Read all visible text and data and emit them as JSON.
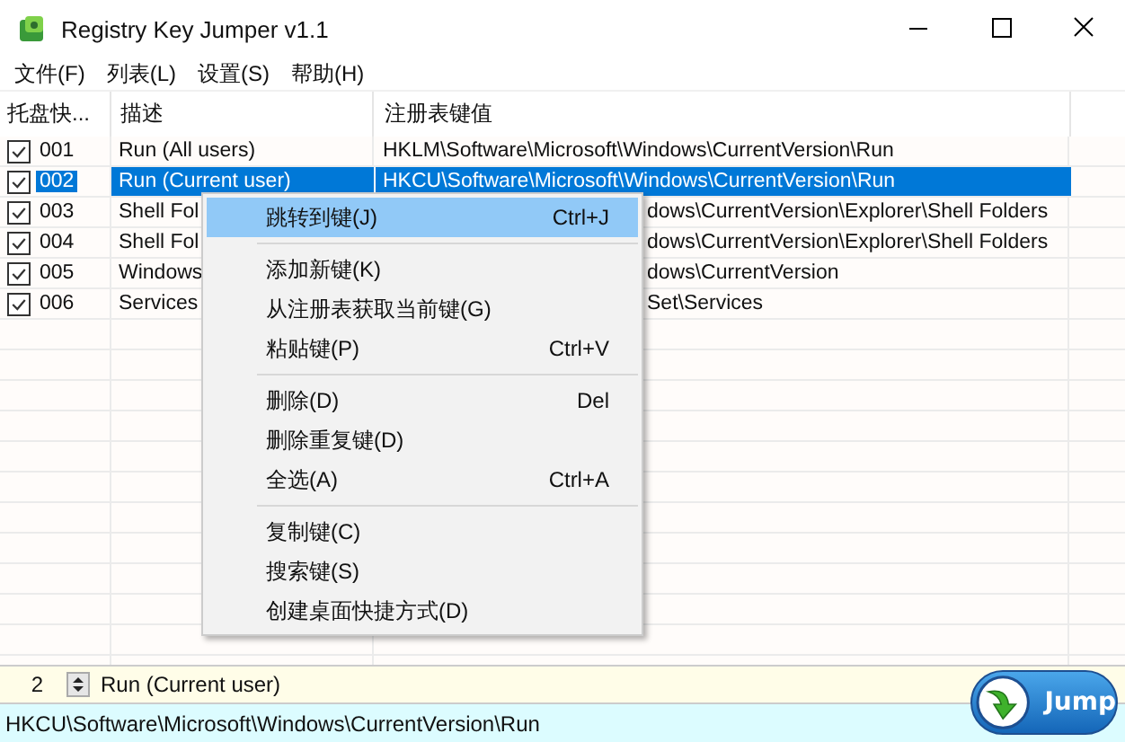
{
  "window": {
    "title": "Registry Key Jumper v1.1"
  },
  "menu_bar": [
    "文件(F)",
    "列表(L)",
    "设置(S)",
    "帮助(H)"
  ],
  "table": {
    "columns": [
      "托盘快...",
      "描述",
      "注册表键值"
    ],
    "rows": [
      {
        "checked": true,
        "selected": false,
        "covered": false,
        "number": "001",
        "description": "Run (All users)",
        "value": "HKLM\\Software\\Microsoft\\Windows\\CurrentVersion\\Run"
      },
      {
        "checked": true,
        "selected": true,
        "covered": false,
        "number": "002",
        "description": "Run (Current user)",
        "value": "HKCU\\Software\\Microsoft\\Windows\\CurrentVersion\\Run"
      },
      {
        "checked": true,
        "selected": false,
        "covered": true,
        "number": "003",
        "description": "Shell Fol",
        "value": "dows\\CurrentVersion\\Explorer\\Shell Folders"
      },
      {
        "checked": true,
        "selected": false,
        "covered": true,
        "number": "004",
        "description": "Shell Fol",
        "value": "dows\\CurrentVersion\\Explorer\\Shell Folders"
      },
      {
        "checked": true,
        "selected": false,
        "covered": true,
        "number": "005",
        "description": "Windows",
        "value": "dows\\CurrentVersion"
      },
      {
        "checked": true,
        "selected": false,
        "covered": true,
        "number": "006",
        "description": "Services",
        "value": "Set\\Services"
      }
    ]
  },
  "context_menu": [
    {
      "kind": "item",
      "label": "跳转到键(J)",
      "shortcut": "Ctrl+J",
      "selected": true
    },
    {
      "kind": "separator"
    },
    {
      "kind": "item",
      "label": "添加新键(K)",
      "selected": false
    },
    {
      "kind": "item",
      "label": "从注册表获取当前键(G)",
      "selected": false
    },
    {
      "kind": "item",
      "label": "粘贴键(P)",
      "shortcut": "Ctrl+V",
      "selected": false
    },
    {
      "kind": "separator"
    },
    {
      "kind": "item",
      "label": "删除(D)",
      "shortcut": "Del",
      "selected": false
    },
    {
      "kind": "item",
      "label": "删除重复键(D)",
      "selected": false
    },
    {
      "kind": "item",
      "label": "全选(A)",
      "shortcut": "Ctrl+A",
      "selected": false
    },
    {
      "kind": "separator"
    },
    {
      "kind": "item",
      "label": "复制键(C)",
      "selected": false
    },
    {
      "kind": "item",
      "label": "搜索键(S)",
      "selected": false
    },
    {
      "kind": "item",
      "label": "创建桌面快捷方式(D)",
      "selected": false
    }
  ],
  "bottom": {
    "number": "2",
    "description": "Run (Current user)",
    "path": "HKCU\\Software\\Microsoft\\Windows\\CurrentVersion\\Run",
    "jump_button": "Jump"
  }
}
